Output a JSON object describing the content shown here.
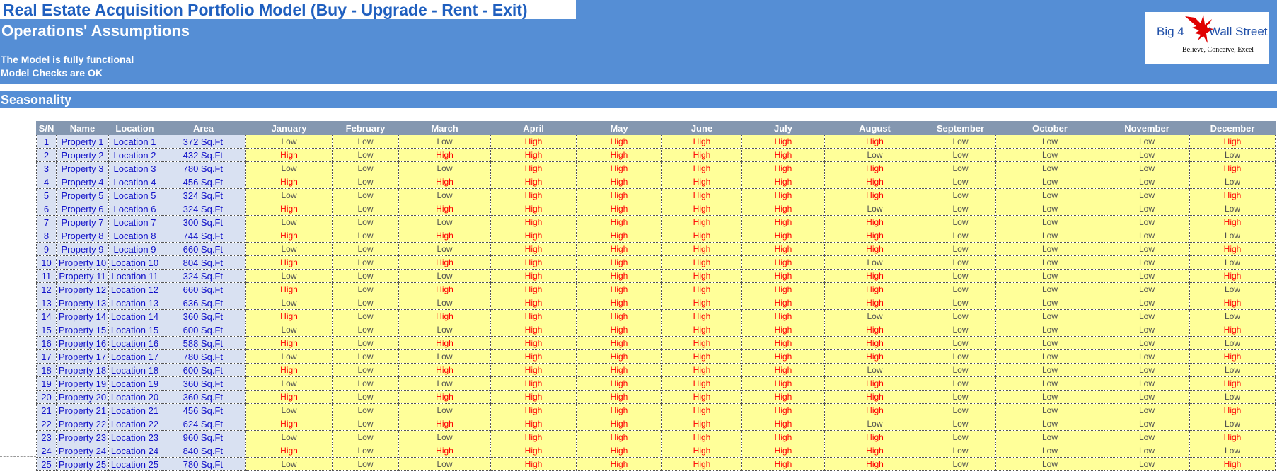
{
  "title": "Real Estate Acquisition Portfolio Model (Buy - Upgrade - Rent - Exit)",
  "subtitle": "Operations' Assumptions",
  "status": [
    "The Model is fully functional",
    "Model Checks are OK"
  ],
  "logo": {
    "left": "Big 4",
    "right": "Wall Street",
    "tagline": "Believe, Conceive, Excel"
  },
  "section": "Seasonality",
  "colors": {
    "header_bg": "#558ED5",
    "table_header_bg": "#8497B0",
    "info_cell_bg": "#D9E1F2",
    "month_cell_bg": "#FFFF99",
    "high_text": "#FF0000",
    "low_text": "#505050",
    "title_text": "#1F5FBF"
  },
  "table": {
    "columns": [
      "S/N",
      "Name",
      "Location",
      "Area",
      "January",
      "February",
      "March",
      "April",
      "May",
      "June",
      "July",
      "August",
      "September",
      "October",
      "November",
      "December"
    ],
    "rows": [
      {
        "sn": "1",
        "name": "Property 1",
        "location": "Location 1",
        "area": "372 Sq.Ft",
        "months": [
          "Low",
          "Low",
          "Low",
          "High",
          "High",
          "High",
          "High",
          "High",
          "Low",
          "Low",
          "Low",
          "High"
        ]
      },
      {
        "sn": "2",
        "name": "Property 2",
        "location": "Location 2",
        "area": "432 Sq.Ft",
        "months": [
          "High",
          "Low",
          "High",
          "High",
          "High",
          "High",
          "High",
          "Low",
          "Low",
          "Low",
          "Low",
          "Low"
        ]
      },
      {
        "sn": "3",
        "name": "Property 3",
        "location": "Location 3",
        "area": "780 Sq.Ft",
        "months": [
          "Low",
          "Low",
          "Low",
          "High",
          "High",
          "High",
          "High",
          "High",
          "Low",
          "Low",
          "Low",
          "High"
        ]
      },
      {
        "sn": "4",
        "name": "Property 4",
        "location": "Location 4",
        "area": "456 Sq.Ft",
        "months": [
          "High",
          "Low",
          "High",
          "High",
          "High",
          "High",
          "High",
          "High",
          "Low",
          "Low",
          "Low",
          "Low"
        ]
      },
      {
        "sn": "5",
        "name": "Property 5",
        "location": "Location 5",
        "area": "324 Sq.Ft",
        "months": [
          "Low",
          "Low",
          "Low",
          "High",
          "High",
          "High",
          "High",
          "High",
          "Low",
          "Low",
          "Low",
          "High"
        ]
      },
      {
        "sn": "6",
        "name": "Property 6",
        "location": "Location 6",
        "area": "324 Sq.Ft",
        "months": [
          "High",
          "Low",
          "High",
          "High",
          "High",
          "High",
          "High",
          "Low",
          "Low",
          "Low",
          "Low",
          "Low"
        ]
      },
      {
        "sn": "7",
        "name": "Property 7",
        "location": "Location 7",
        "area": "300 Sq.Ft",
        "months": [
          "Low",
          "Low",
          "Low",
          "High",
          "High",
          "High",
          "High",
          "High",
          "Low",
          "Low",
          "Low",
          "High"
        ]
      },
      {
        "sn": "8",
        "name": "Property 8",
        "location": "Location 8",
        "area": "744 Sq.Ft",
        "months": [
          "High",
          "Low",
          "High",
          "High",
          "High",
          "High",
          "High",
          "High",
          "Low",
          "Low",
          "Low",
          "Low"
        ]
      },
      {
        "sn": "9",
        "name": "Property 9",
        "location": "Location 9",
        "area": "660 Sq.Ft",
        "months": [
          "Low",
          "Low",
          "Low",
          "High",
          "High",
          "High",
          "High",
          "High",
          "Low",
          "Low",
          "Low",
          "High"
        ]
      },
      {
        "sn": "10",
        "name": "Property 10",
        "location": "Location 10",
        "area": "804 Sq.Ft",
        "months": [
          "High",
          "Low",
          "High",
          "High",
          "High",
          "High",
          "High",
          "Low",
          "Low",
          "Low",
          "Low",
          "Low"
        ]
      },
      {
        "sn": "11",
        "name": "Property 11",
        "location": "Location 11",
        "area": "324 Sq.Ft",
        "months": [
          "Low",
          "Low",
          "Low",
          "High",
          "High",
          "High",
          "High",
          "High",
          "Low",
          "Low",
          "Low",
          "High"
        ]
      },
      {
        "sn": "12",
        "name": "Property 12",
        "location": "Location 12",
        "area": "660 Sq.Ft",
        "months": [
          "High",
          "Low",
          "High",
          "High",
          "High",
          "High",
          "High",
          "High",
          "Low",
          "Low",
          "Low",
          "Low"
        ]
      },
      {
        "sn": "13",
        "name": "Property 13",
        "location": "Location 13",
        "area": "636 Sq.Ft",
        "months": [
          "Low",
          "Low",
          "Low",
          "High",
          "High",
          "High",
          "High",
          "High",
          "Low",
          "Low",
          "Low",
          "High"
        ]
      },
      {
        "sn": "14",
        "name": "Property 14",
        "location": "Location 14",
        "area": "360 Sq.Ft",
        "months": [
          "High",
          "Low",
          "High",
          "High",
          "High",
          "High",
          "High",
          "Low",
          "Low",
          "Low",
          "Low",
          "Low"
        ]
      },
      {
        "sn": "15",
        "name": "Property 15",
        "location": "Location 15",
        "area": "600 Sq.Ft",
        "months": [
          "Low",
          "Low",
          "Low",
          "High",
          "High",
          "High",
          "High",
          "High",
          "Low",
          "Low",
          "Low",
          "High"
        ]
      },
      {
        "sn": "16",
        "name": "Property 16",
        "location": "Location 16",
        "area": "588 Sq.Ft",
        "months": [
          "High",
          "Low",
          "High",
          "High",
          "High",
          "High",
          "High",
          "High",
          "Low",
          "Low",
          "Low",
          "Low"
        ]
      },
      {
        "sn": "17",
        "name": "Property 17",
        "location": "Location 17",
        "area": "780 Sq.Ft",
        "months": [
          "Low",
          "Low",
          "Low",
          "High",
          "High",
          "High",
          "High",
          "High",
          "Low",
          "Low",
          "Low",
          "High"
        ]
      },
      {
        "sn": "18",
        "name": "Property 18",
        "location": "Location 18",
        "area": "600 Sq.Ft",
        "months": [
          "High",
          "Low",
          "High",
          "High",
          "High",
          "High",
          "High",
          "Low",
          "Low",
          "Low",
          "Low",
          "Low"
        ]
      },
      {
        "sn": "19",
        "name": "Property 19",
        "location": "Location 19",
        "area": "360 Sq.Ft",
        "months": [
          "Low",
          "Low",
          "Low",
          "High",
          "High",
          "High",
          "High",
          "High",
          "Low",
          "Low",
          "Low",
          "High"
        ]
      },
      {
        "sn": "20",
        "name": "Property 20",
        "location": "Location 20",
        "area": "360 Sq.Ft",
        "months": [
          "High",
          "Low",
          "High",
          "High",
          "High",
          "High",
          "High",
          "High",
          "Low",
          "Low",
          "Low",
          "Low"
        ]
      },
      {
        "sn": "21",
        "name": "Property 21",
        "location": "Location 21",
        "area": "456 Sq.Ft",
        "months": [
          "Low",
          "Low",
          "Low",
          "High",
          "High",
          "High",
          "High",
          "High",
          "Low",
          "Low",
          "Low",
          "High"
        ]
      },
      {
        "sn": "22",
        "name": "Property 22",
        "location": "Location 22",
        "area": "624 Sq.Ft",
        "months": [
          "High",
          "Low",
          "High",
          "High",
          "High",
          "High",
          "High",
          "Low",
          "Low",
          "Low",
          "Low",
          "Low"
        ]
      },
      {
        "sn": "23",
        "name": "Property 23",
        "location": "Location 23",
        "area": "960 Sq.Ft",
        "months": [
          "Low",
          "Low",
          "Low",
          "High",
          "High",
          "High",
          "High",
          "High",
          "Low",
          "Low",
          "Low",
          "High"
        ]
      },
      {
        "sn": "24",
        "name": "Property 24",
        "location": "Location 24",
        "area": "840 Sq.Ft",
        "months": [
          "High",
          "Low",
          "High",
          "High",
          "High",
          "High",
          "High",
          "High",
          "Low",
          "Low",
          "Low",
          "Low"
        ]
      },
      {
        "sn": "25",
        "name": "Property 25",
        "location": "Location 25",
        "area": "780 Sq.Ft",
        "months": [
          "Low",
          "Low",
          "Low",
          "High",
          "High",
          "High",
          "High",
          "High",
          "Low",
          "Low",
          "Low",
          "High"
        ]
      }
    ]
  }
}
